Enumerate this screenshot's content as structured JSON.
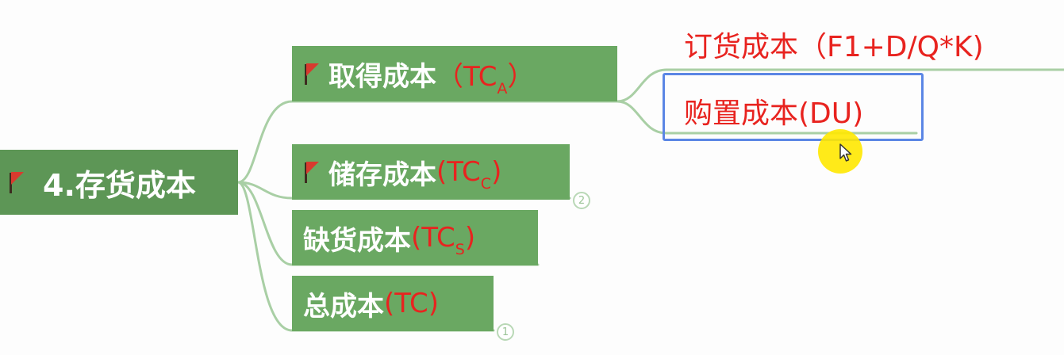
{
  "root": {
    "label": "4.存货成本"
  },
  "branches": [
    {
      "label": "取得成本",
      "suffix_open": "（TC",
      "suffix_sub": "A",
      "suffix_close": "）"
    },
    {
      "label": "储存成本",
      "suffix_open": "(TC",
      "suffix_sub": "C",
      "suffix_close": ")",
      "badge": "2"
    },
    {
      "label": "缺货成本",
      "suffix_open": "(TC",
      "suffix_sub": "S",
      "suffix_close": ")"
    },
    {
      "label": "总成本",
      "suffix_open": "(TC)",
      "suffix_sub": "",
      "suffix_close": "",
      "badge": "1"
    }
  ],
  "leaves": [
    {
      "text": "订货成本（F1+D/Q*K)"
    },
    {
      "text": "购置成本(DU)",
      "selected": true
    }
  ],
  "colors": {
    "root_bg": "#5d9656",
    "branch_bg": "#6aa862",
    "connector": "#a9cfa5",
    "accent_red": "#e8231f",
    "selection_blue": "#5b86e5"
  },
  "icons": {
    "flag": "flag-icon",
    "cursor": "mouse-cursor-icon"
  }
}
